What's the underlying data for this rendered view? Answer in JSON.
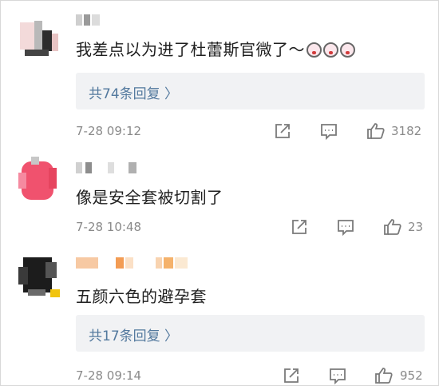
{
  "comments": [
    {
      "text": "我差点以为进了杜蕾斯官微了～",
      "emoji_count": 3,
      "replies_label": "共74条回复 〉",
      "time": "7-28 09:12",
      "likes": "3182"
    },
    {
      "text": "像是安全套被切割了",
      "time": "7-28 10:48",
      "likes": "23"
    },
    {
      "text": "五颜六色的避孕套",
      "replies_label": "共17条回复 〉",
      "time": "7-28 09:14",
      "likes": "952"
    }
  ],
  "icons": {
    "share": "share-icon",
    "comment": "comment-icon",
    "like": "like-icon",
    "reaction": "laughing-emoji-icon"
  },
  "colors": {
    "text": "#1f1f1f",
    "meta": "#8a8a8a",
    "reply_link": "#53799e",
    "reply_bg": "#f1f2f4"
  }
}
